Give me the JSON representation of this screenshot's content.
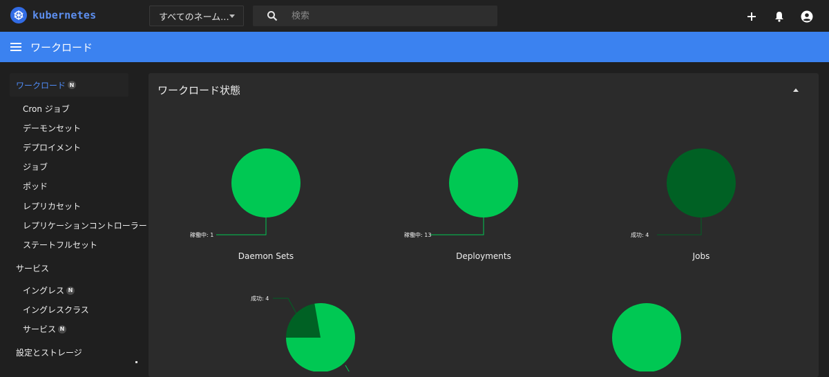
{
  "app": {
    "logo_text": "kubernetes"
  },
  "header": {
    "namespace_select": "すべてのネーム...",
    "search_placeholder": "検索"
  },
  "bluebar": {
    "title": "ワークロード"
  },
  "sidebar": {
    "active": {
      "label": "ワークロード",
      "badge": "N"
    },
    "items": [
      {
        "label": "Cron ジョブ"
      },
      {
        "label": "デーモンセット"
      },
      {
        "label": "デプロイメント"
      },
      {
        "label": "ジョブ"
      },
      {
        "label": "ポッド"
      },
      {
        "label": "レプリカセット"
      },
      {
        "label": "レプリケーションコントローラー"
      },
      {
        "label": "ステートフルセット"
      }
    ],
    "group_services": "サービス",
    "service_items": [
      {
        "label": "イングレス",
        "badge": "N"
      },
      {
        "label": "イングレスクラス"
      },
      {
        "label": "サービス",
        "badge": "N"
      }
    ],
    "group_storage": "設定とストレージ"
  },
  "card": {
    "title": "ワークロード状態"
  },
  "colors": {
    "running": "#00c853",
    "succeeded": "#006124",
    "accent": "#326ce5"
  },
  "chart_data": [
    {
      "type": "pie",
      "title": "Daemon Sets",
      "slices": [
        {
          "label": "稼働中: 1",
          "value": 1
        }
      ]
    },
    {
      "type": "pie",
      "title": "Deployments",
      "slices": [
        {
          "label": "稼働中: 13",
          "value": 13
        }
      ]
    },
    {
      "type": "pie",
      "title": "Jobs",
      "slices": [
        {
          "label": "成功: 4",
          "value": 4,
          "status": "succeeded"
        }
      ]
    },
    {
      "type": "pie",
      "title": "",
      "slices": [
        {
          "label": "成功: 4",
          "value": 4,
          "status": "succeeded"
        },
        {
          "label": "",
          "value": 14,
          "status": "running"
        }
      ]
    },
    {
      "type": "pie",
      "title": "",
      "slices": [
        {
          "label": "",
          "value": 1,
          "status": "running"
        }
      ]
    }
  ]
}
